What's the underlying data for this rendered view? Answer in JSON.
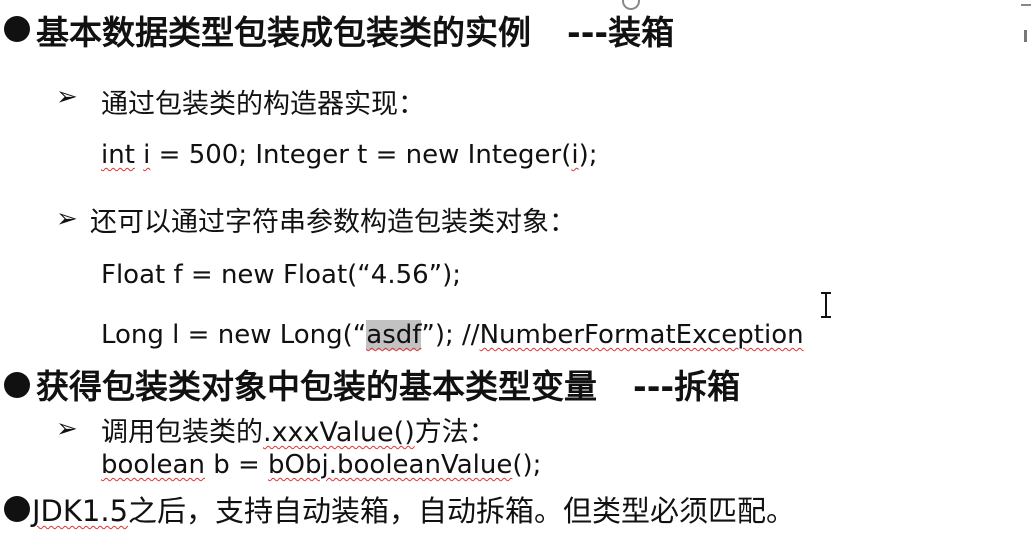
{
  "sections": [
    {
      "heading": "基本数据类型包装成包装类的实例",
      "suffix": "---装箱",
      "items": [
        {
          "text": "通过包装类的构造器实现："
        },
        {
          "text": "还可以通过字符串参数构造包装类对象："
        }
      ],
      "code": {
        "line1_a": "int",
        "line1_b": " ",
        "line1_c": "i",
        "line1_d": " = 500;   Integer t = new Integer(",
        "line1_e": "i",
        "line1_f": ");",
        "line2": "Float f = new Float(“4.56”);",
        "line3_a": "Long l = new Long(“",
        "line3_b": "asdf",
        "line3_c": "”);  //",
        "line3_d": "NumberFormatException"
      }
    },
    {
      "heading": "获得包装类对象中包装的基本类型变量",
      "suffix": "---拆箱",
      "item_a": "调用包装类的",
      "item_b": ".xxxValue()",
      "item_c": "方法：",
      "code_a": "boolean",
      "code_b": " b = ",
      "code_c": "bObj.booleanValue",
      "code_d": "();"
    },
    {
      "text_a": "JDK1.5",
      "text_b": "之后，支持自动装箱，自动拆箱。但类型必须匹配。"
    }
  ]
}
